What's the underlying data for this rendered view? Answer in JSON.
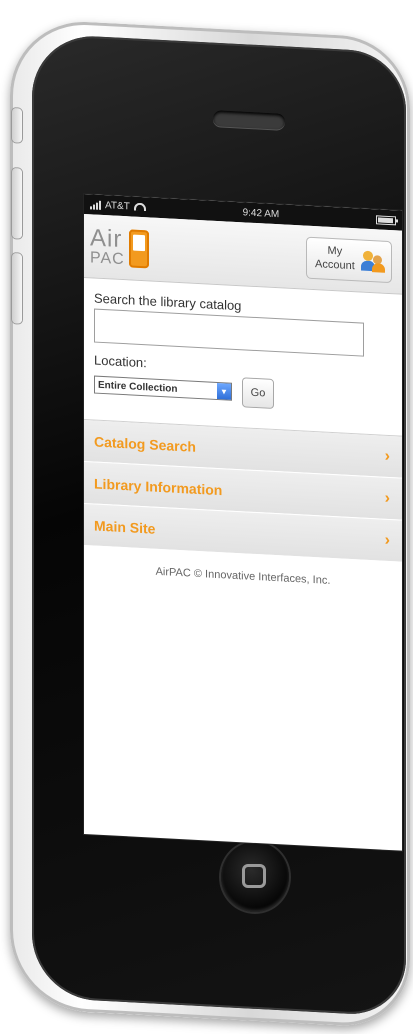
{
  "status_bar": {
    "carrier": "AT&T",
    "time": "9:42 AM"
  },
  "header": {
    "logo_air": "Air",
    "logo_pac": "PAC",
    "account_line1": "My",
    "account_line2": "Account"
  },
  "search": {
    "label": "Search the library catalog",
    "value": "",
    "location_label": "Location:",
    "location_selected": "Entire Collection",
    "go_label": "Go"
  },
  "menu": {
    "items": [
      {
        "label": "Catalog Search"
      },
      {
        "label": "Library Information"
      },
      {
        "label": "Main Site"
      }
    ]
  },
  "footer": {
    "text": "AirPAC © Innovative Interfaces, Inc."
  },
  "colors": {
    "accent": "#f29a1f",
    "header_bg": "#e6e6e6",
    "phone_black": "#050505"
  }
}
